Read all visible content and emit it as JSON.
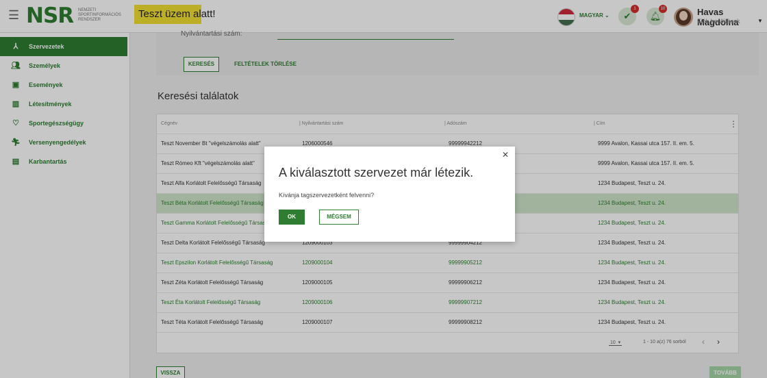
{
  "header": {
    "logo": "NSR",
    "logo_sub": [
      "NEMZETI",
      "SPORTINFORMÁCIÓS",
      "RENDSZER"
    ],
    "test_banner": "Teszt üzem alatt!",
    "language": "MAGYAR",
    "tasks_badge": "1",
    "notifications_badge": "10",
    "user_name": "Havas Magdolna",
    "user_sub": "Fiók beállítások"
  },
  "sidebar": {
    "items": [
      {
        "label": "Szervezetek",
        "icon": "org-tree-icon",
        "active": true
      },
      {
        "label": "Személyek",
        "icon": "people-icon"
      },
      {
        "label": "Események",
        "icon": "calendar-icon"
      },
      {
        "label": "Létesítmények",
        "icon": "building-icon"
      },
      {
        "label": "Sportegészségügy",
        "icon": "heart-icon"
      },
      {
        "label": "Versenyengedélyek",
        "icon": "runner-icon"
      },
      {
        "label": "Karbantartás",
        "icon": "clipboard-icon"
      }
    ]
  },
  "search": {
    "field_label": "Nyilvántartási szám:",
    "search_button": "KERESÉS",
    "clear_button": "FELTÉTELEK TÖRLÉSE"
  },
  "results": {
    "title": "Keresési találatok",
    "columns": [
      "Cégnév",
      "Nyilvántartási szám",
      "Adószám",
      "Cím"
    ],
    "rows": [
      {
        "name": "Teszt November Bt \"végelszámolás alatt\"",
        "reg": "1206000546",
        "tax": "99999942212",
        "addr": "9999 Avalon, Kassai utca 157. II. em. 5."
      },
      {
        "name": "Teszt Rómeo Kft \"végelszámolás alatt\"",
        "reg": "",
        "tax": "",
        "addr": "9999 Avalon, Kassai utca 157. II. em. 5."
      },
      {
        "name": "Teszt Alfa Korlátolt Felelősségű Társaság",
        "reg": "",
        "tax": "",
        "addr": "1234 Budapest, Teszt u. 24."
      },
      {
        "name": "Teszt Béta Korlátolt Felelősségű Társaság",
        "reg": "",
        "tax": "",
        "addr": "1234 Budapest, Teszt u. 24."
      },
      {
        "name": "Teszt Gamma Korlátolt Felelősségű Társaság",
        "reg": "",
        "tax": "",
        "addr": "1234 Budapest, Teszt u. 24."
      },
      {
        "name": "Teszt Delta Korlátolt Felelősségű Társaság",
        "reg": "1209000103",
        "tax": "99999904212",
        "addr": "1234 Budapest, Teszt u. 24."
      },
      {
        "name": "Teszt Epszilon Korlátolt Felelősségű Társaság",
        "reg": "1209000104",
        "tax": "99999905212",
        "addr": "1234 Budapest, Teszt u. 24."
      },
      {
        "name": "Teszt Zéta Korlátolt Felelősségű Társaság",
        "reg": "1209000105",
        "tax": "99999906212",
        "addr": "1234 Budapest, Teszt u. 24."
      },
      {
        "name": "Teszt Éta Korlátolt Felelősségű Társaság",
        "reg": "1209000106",
        "tax": "99999907212",
        "addr": "1234 Budapest, Teszt u. 24."
      },
      {
        "name": "Teszt Téta Korlátolt Felelősségű Társaság",
        "reg": "1209000107",
        "tax": "99999908212",
        "addr": "1234 Budapest, Teszt u. 24."
      }
    ],
    "page_size": "10",
    "page_info": "1 - 10 a(z) 76 sorból"
  },
  "footer": {
    "back_button": "VISSZA",
    "next_button": "TOVÁBB"
  },
  "modal": {
    "title": "A kiválasztott szervezet már létezik.",
    "text": "Kívánja tagszervezetként felvenni?",
    "ok_button": "OK",
    "cancel_button": "MÉGSEM"
  },
  "colors": {
    "primary": "#2e7d32",
    "banner": "#f3df34",
    "selected_row": "#cfe6c9"
  }
}
